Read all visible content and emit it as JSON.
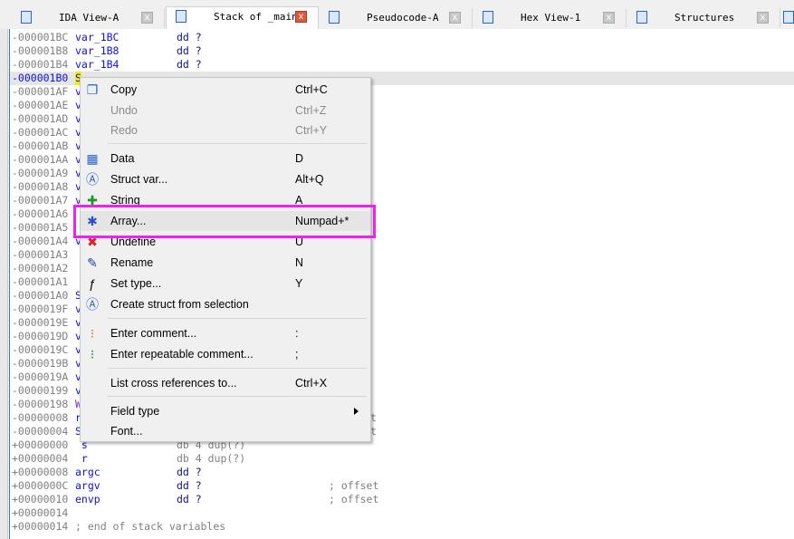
{
  "tabs": [
    {
      "label": "IDA View-A",
      "icon": "disassembly-icon",
      "active": false
    },
    {
      "label": "Stack of _main",
      "icon": "stack-icon",
      "active": true
    },
    {
      "label": "Pseudocode-A",
      "icon": "pseudocode-icon",
      "active": false
    },
    {
      "label": "Hex View-1",
      "icon": "hex-icon",
      "active": false
    },
    {
      "label": "Structures",
      "icon": "structures-icon",
      "active": false
    }
  ],
  "close_glyph": "x",
  "rows": [
    {
      "off": "-000001BC",
      "name": "var_1BC",
      "type": "dd ?",
      "comment": ""
    },
    {
      "off": "-000001B8",
      "name": "var_1B8",
      "type": "dd ?",
      "comment": ""
    },
    {
      "off": "-000001B4",
      "name": "var_1B4",
      "type": "dd ?",
      "comment": ""
    },
    {
      "off": "-000001B0",
      "name": "S",
      "type": "",
      "comment": ""
    },
    {
      "off": "-000001AF",
      "name": "v",
      "type": "",
      "comment": ""
    },
    {
      "off": "-000001AE",
      "name": "v",
      "type": "",
      "comment": ""
    },
    {
      "off": "-000001AD",
      "name": "v",
      "type": "",
      "comment": ""
    },
    {
      "off": "-000001AC",
      "name": "v",
      "type": "",
      "comment": ""
    },
    {
      "off": "-000001AB",
      "name": "v",
      "type": "",
      "comment": ""
    },
    {
      "off": "-000001AA",
      "name": "v",
      "type": "",
      "comment": ""
    },
    {
      "off": "-000001A9",
      "name": "v",
      "type": "",
      "comment": ""
    },
    {
      "off": "-000001A8",
      "name": "v",
      "type": "",
      "comment": ""
    },
    {
      "off": "-000001A7",
      "name": "v",
      "type": "",
      "comment": ""
    },
    {
      "off": "-000001A6",
      "name": "",
      "type": "",
      "comment": ""
    },
    {
      "off": "-000001A5",
      "name": "",
      "type": "",
      "comment": ""
    },
    {
      "off": "-000001A4",
      "name": "v",
      "type": "",
      "comment": ""
    },
    {
      "off": "-000001A3",
      "name": "",
      "type": "",
      "comment": ""
    },
    {
      "off": "-000001A2",
      "name": "",
      "type": "",
      "comment": ""
    },
    {
      "off": "-000001A1",
      "name": "",
      "type": "",
      "comment": ""
    },
    {
      "off": "-000001A0",
      "name": "S",
      "type": "",
      "comment": ""
    },
    {
      "off": "-0000019F",
      "name": "v",
      "type": "",
      "comment": ""
    },
    {
      "off": "-0000019E",
      "name": "v",
      "type": "",
      "comment": ""
    },
    {
      "off": "-0000019D",
      "name": "v",
      "type": "",
      "comment": ""
    },
    {
      "off": "-0000019C",
      "name": "v",
      "type": "",
      "comment": ""
    },
    {
      "off": "-0000019B",
      "name": "v",
      "type": "",
      "comment": ""
    },
    {
      "off": "-0000019A",
      "name": "v",
      "type": "",
      "comment": ""
    },
    {
      "off": "-00000199",
      "name": "v",
      "type": "",
      "comment": ""
    },
    {
      "off": "-00000198",
      "name": "W",
      "type": "",
      "comment": ""
    },
    {
      "off": "-00000008",
      "name": "r",
      "type": "",
      "comment": "t"
    },
    {
      "off": "-00000004",
      "name": "S",
      "type": "",
      "comment": "t"
    },
    {
      "off": "+00000000",
      "name": " s",
      "type": "db 4 dup(?)",
      "comment": ""
    },
    {
      "off": "+00000004",
      "name": " r",
      "type": "db 4 dup(?)",
      "comment": ""
    },
    {
      "off": "+00000008",
      "name": "argc",
      "type": "dd ?",
      "comment": ""
    },
    {
      "off": "+0000000C",
      "name": "argv",
      "type": "dd ?",
      "comment": "; offset"
    },
    {
      "off": "+00000010",
      "name": "envp",
      "type": "dd ?",
      "comment": "; offset"
    },
    {
      "off": "+00000014",
      "name": "",
      "type": "",
      "comment": ""
    },
    {
      "off": "+00000014",
      "name": "; end of stack variables",
      "type": "",
      "comment": ""
    }
  ],
  "menu": {
    "items": [
      {
        "label": "Copy",
        "shortcut": "Ctrl+C",
        "icon": "copy-icon",
        "disabled": false
      },
      {
        "label": "Undo",
        "shortcut": "Ctrl+Z",
        "icon": "",
        "disabled": true
      },
      {
        "label": "Redo",
        "shortcut": "Ctrl+Y",
        "icon": "",
        "disabled": true
      },
      {
        "label": "Data",
        "shortcut": "D",
        "icon": "data-icon",
        "disabled": false
      },
      {
        "label": "Struct var...",
        "shortcut": "Alt+Q",
        "icon": "struct-var-icon",
        "disabled": false
      },
      {
        "label": "String",
        "shortcut": "A",
        "icon": "string-icon",
        "disabled": false
      },
      {
        "label": "Array...",
        "shortcut": "Numpad+*",
        "icon": "array-icon",
        "disabled": false
      },
      {
        "label": "Undefine",
        "shortcut": "U",
        "icon": "undefine-icon",
        "disabled": false
      },
      {
        "label": "Rename",
        "shortcut": "N",
        "icon": "rename-icon",
        "disabled": false
      },
      {
        "label": "Set type...",
        "shortcut": "Y",
        "icon": "set-type-icon",
        "disabled": false
      },
      {
        "label": "Create struct from selection",
        "shortcut": "",
        "icon": "create-struct-icon",
        "disabled": false
      },
      {
        "label": "Enter comment...",
        "shortcut": ":",
        "icon": "comment-icon",
        "disabled": false
      },
      {
        "label": "Enter repeatable comment...",
        "shortcut": ";",
        "icon": "repeatable-comment-icon",
        "disabled": false
      },
      {
        "label": "List cross references to...",
        "shortcut": "Ctrl+X",
        "icon": "",
        "disabled": false
      },
      {
        "label": "Field type",
        "shortcut": "",
        "icon": "",
        "disabled": false,
        "submenu": true
      },
      {
        "label": "Font...",
        "shortcut": "",
        "icon": "",
        "disabled": false
      }
    ]
  },
  "colors": {
    "highlight_box": "#f020f0",
    "selection": "#f0f000",
    "name_blue": "#1010e0"
  }
}
